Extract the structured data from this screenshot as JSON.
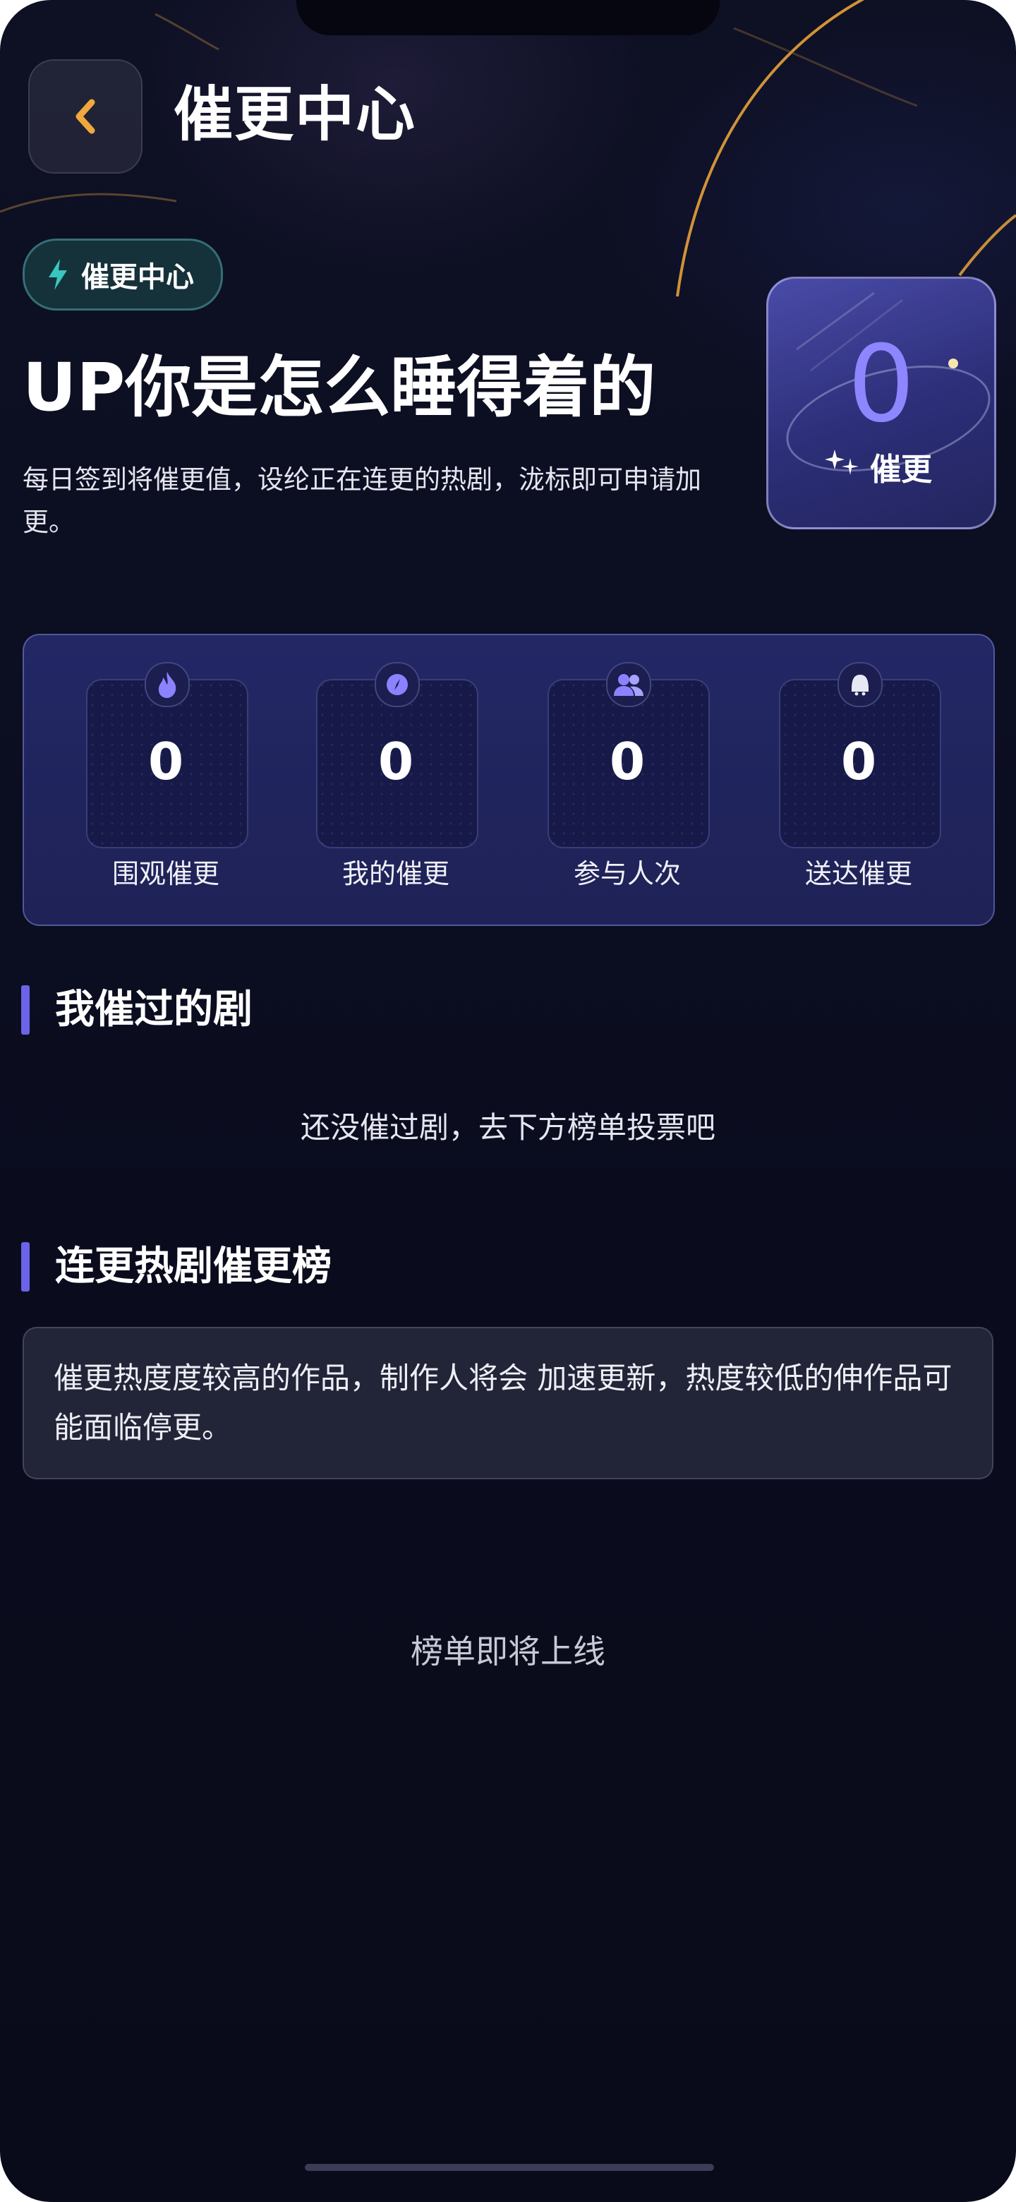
{
  "header": {
    "title": "催更中心"
  },
  "badge": {
    "label": "催更中心"
  },
  "hero": {
    "title": "UP你是怎么睡得着的",
    "description": "每日签到将催更值，设纶正在连更的热剧，泷标即可申请加更。"
  },
  "urge_card": {
    "count": "0",
    "label": "催更"
  },
  "stats": [
    {
      "value": "0",
      "label": "围观催更",
      "icon": "fire-icon"
    },
    {
      "value": "0",
      "label": "我的催更",
      "icon": "compass-icon"
    },
    {
      "value": "0",
      "label": "参与人次",
      "icon": "users-icon"
    },
    {
      "value": "0",
      "label": "送达催更",
      "icon": "bell-icon"
    }
  ],
  "my_urged": {
    "title": "我催过的剧",
    "empty_text": "还没催过剧，去下方榜单投票吧"
  },
  "ranking": {
    "title": "连更热剧催更榜",
    "notice": "催更热度度较高的作品，制作人将会 加速更新，热度较低的伸作品可能面临停更。",
    "empty_text": "榜单即将上线"
  },
  "colors": {
    "accent": "#6b63e8",
    "back_arrow": "#f0a83c",
    "badge_icon": "#38c6c0"
  }
}
